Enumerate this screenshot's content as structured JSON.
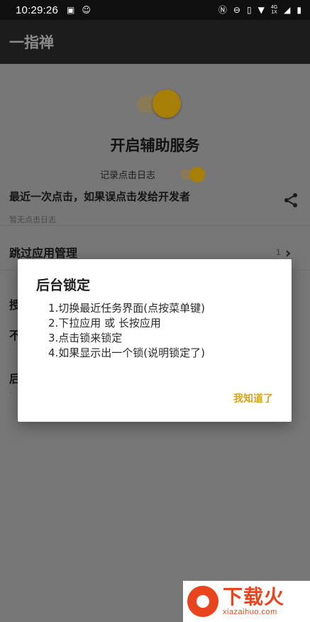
{
  "status_bar": {
    "time": "10:29:26",
    "network": "4G",
    "network_sub": "1X"
  },
  "app_bar": {
    "title": "一指禅"
  },
  "main": {
    "service_title": "开启辅助服务",
    "log_toggle_label": "记录点击日志",
    "recent_click_title": "最近一次点击，如果误点击发给开发者",
    "no_log_text": "暂无点击日志",
    "skip_app_manage": "跳过应用管理",
    "skip_count": "1",
    "peek_items": [
      "授",
      "不",
      "后"
    ]
  },
  "dialog": {
    "title": "后台锁定",
    "steps": [
      "1.切换最近任务界面(点按菜单键)",
      "2.下拉应用 或 长按应用",
      "3.点击锁来锁定",
      "4.如果显示出一个锁(说明锁定了)"
    ],
    "confirm_label": "我知道了"
  },
  "watermark": {
    "cn": "下载火",
    "en": "xiazaihuo.com"
  },
  "colors": {
    "accent": "#f5b700",
    "dialog_button": "#d5a51b",
    "watermark": "#e8451f"
  }
}
